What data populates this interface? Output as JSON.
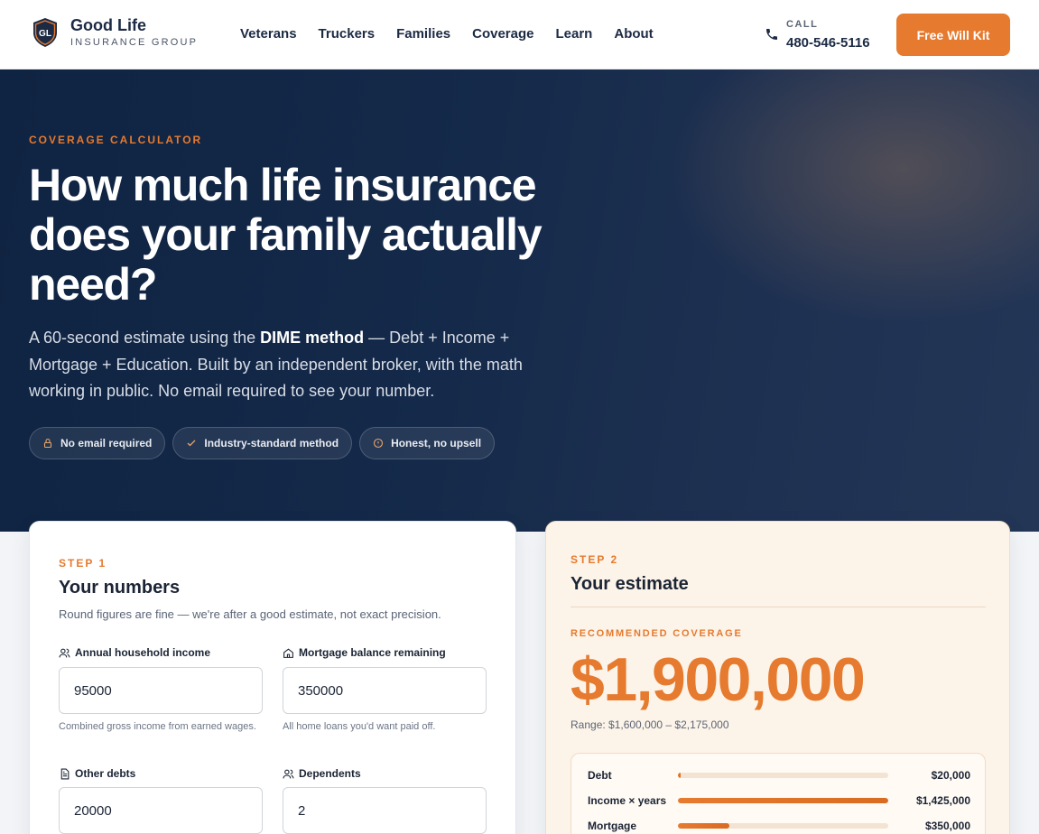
{
  "nav": {
    "brand_name": "Good Life",
    "brand_sub": "INSURANCE GROUP",
    "brand_monogram": "GL",
    "links": [
      "Veterans",
      "Truckers",
      "Families",
      "Coverage",
      "Learn",
      "About"
    ],
    "call_label": "CALL",
    "call_number": "480-546-5116",
    "cta_label": "Free Will Kit"
  },
  "hero": {
    "eyebrow": "COVERAGE CALCULATOR",
    "title": "How much life insurance does your family actually need?",
    "desc_before": "A 60-second estimate using the ",
    "desc_bold": "DIME method",
    "desc_after": " — Debt + Income + Mortgage + Education. Built by an independent broker, with the math working in public. No email required to see your number.",
    "pills": [
      {
        "icon": "lock-icon",
        "label": "No email required"
      },
      {
        "icon": "check-icon",
        "label": "Industry-standard method"
      },
      {
        "icon": "info-icon",
        "label": "Honest, no upsell"
      }
    ]
  },
  "step1": {
    "step": "STEP 1",
    "title": "Your numbers",
    "subtitle": "Round figures are fine — we're after a good estimate, not exact precision.",
    "fields": {
      "income": {
        "label": "Annual household income",
        "value": "95000",
        "help": "Combined gross income from earned wages.",
        "icon": "users-icon"
      },
      "mortgage": {
        "label": "Mortgage balance remaining",
        "value": "350000",
        "help": "All home loans you'd want paid off.",
        "icon": "home-icon"
      },
      "debts": {
        "label": "Other debts",
        "value": "20000",
        "icon": "document-icon"
      },
      "dependents": {
        "label": "Dependents",
        "value": "2",
        "icon": "users-icon"
      }
    }
  },
  "step2": {
    "step": "STEP 2",
    "title": "Your estimate",
    "rec_label": "RECOMMENDED COVERAGE",
    "amount": "$1,900,000",
    "range": "Range: $1,600,000 – $2,175,000",
    "breakdown": [
      {
        "label": "Debt",
        "value": "$20,000",
        "fraction": 0.014
      },
      {
        "label": "Income × years",
        "value": "$1,425,000",
        "fraction": 1.0
      },
      {
        "label": "Mortgage",
        "value": "$350,000",
        "fraction": 0.245
      }
    ]
  },
  "colors": {
    "accent": "#e67a2e",
    "navy": "#0f2342",
    "estimate_bg": "#fdf4e9"
  }
}
